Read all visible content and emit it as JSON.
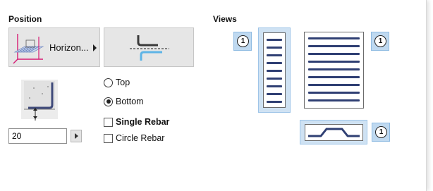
{
  "position": {
    "title": "Position",
    "horizontal_label": "Horizon...",
    "spacing_value": "20",
    "top_label": "Top",
    "bottom_label": "Bottom",
    "single_rebar_label": "Single Rebar",
    "circle_rebar_label": "Circle Rebar",
    "selected_side": "Bottom",
    "single_rebar_checked": false,
    "circle_rebar_checked": false
  },
  "views": {
    "title": "Views",
    "badge_left": "1",
    "badge_right": "1",
    "badge_bottom": "1"
  },
  "colors": {
    "selection_blue": "#bfd9f0",
    "bar_color": "#2f3f73",
    "tile_gray": "#e6e6e6"
  }
}
